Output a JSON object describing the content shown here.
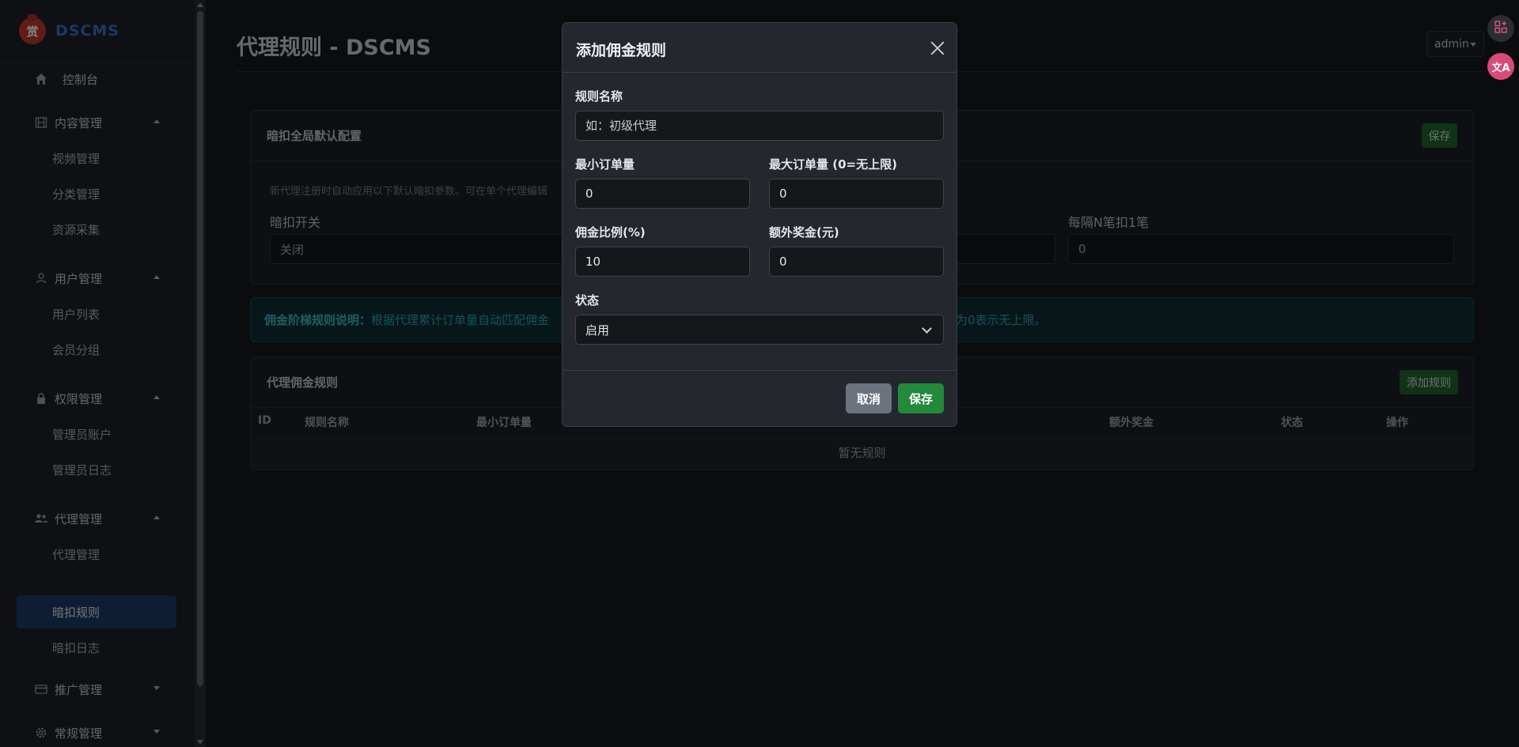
{
  "brand": {
    "name": "DSCMS",
    "logo_glyph": "赏"
  },
  "sidebar": {
    "items": [
      {
        "label": "控制台",
        "icon": "home-icon"
      },
      {
        "label": "内容管理",
        "icon": "film-icon"
      },
      {
        "label": "视频管理"
      },
      {
        "label": "分类管理"
      },
      {
        "label": "资源采集"
      },
      {
        "label": "用户管理",
        "icon": "person-icon"
      },
      {
        "label": "用户列表"
      },
      {
        "label": "会员分组"
      },
      {
        "label": "权限管理",
        "icon": "lock-icon"
      },
      {
        "label": "管理员账户"
      },
      {
        "label": "管理员日志"
      },
      {
        "label": "代理管理",
        "icon": "people-icon"
      },
      {
        "label": "代理管理"
      },
      {
        "label": "暗扣规则"
      },
      {
        "label": "暗扣日志"
      },
      {
        "label": "推广管理",
        "icon": "card-icon"
      },
      {
        "label": "常规管理",
        "icon": "gear-icon"
      }
    ],
    "active": "暗扣规则"
  },
  "header": {
    "title": "代理规则 - DSCMS",
    "user": "admin"
  },
  "global_config": {
    "title": "暗扣全局默认配置",
    "save_label": "保存",
    "hint": "新代理注册时自动应用以下默认暗扣参数。可在单个代理编辑",
    "switch_label": "暗扣开关",
    "switch_value": "关闭",
    "every_n_label": "每隔N笔扣1笔",
    "every_n_value": "0"
  },
  "info_banner": {
    "bold": "佣金阶梯规则说明：",
    "text": "根据代理累计订单量自动匹配佣金",
    "tail": "为0表示无上限。"
  },
  "rules_table": {
    "title": "代理佣金规则",
    "add_label": "添加规则",
    "headers": [
      "ID",
      "规则名称",
      "最小订单量",
      "额外奖金",
      "状态",
      "操作"
    ],
    "empty": "暂无规则"
  },
  "modal": {
    "title": "添加佣金规则",
    "name_label": "规则名称",
    "name_placeholder": "如：初级代理",
    "min_label": "最小订单量",
    "min_value": "0",
    "max_label": "最大订单量 (0=无上限)",
    "max_value": "0",
    "rate_label": "佣金比例(%)",
    "rate_value": "10",
    "bonus_label": "额外奖金(元)",
    "bonus_value": "0",
    "status_label": "状态",
    "status_value": "启用",
    "cancel_label": "取消",
    "save_label": "保存"
  },
  "side_tools": {
    "translate_glyph": "文A"
  }
}
